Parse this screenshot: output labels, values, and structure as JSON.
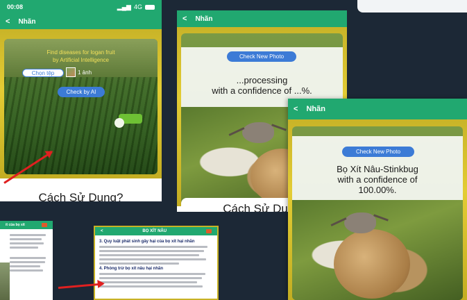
{
  "screenA": {
    "status_time": "00:08",
    "status_signal": "4G",
    "status_battery": "",
    "appbar_back": "<",
    "appbar_title": "Nhãn",
    "headline_line1": "Find diseases for logan fruit",
    "headline_line2": "by Artificial Intelligence",
    "choose_file_label": "Chọn tệp",
    "file_count_label": "1 ảnh",
    "check_ai_label": "Check by AI",
    "usage_title": "Cách Sử Dụng?"
  },
  "screenB": {
    "appbar_back": "<",
    "appbar_title": "Nhãn",
    "check_photo_label": "Check New Photo",
    "processing_line1": "...processing",
    "processing_line2": "with a confidence of ...%.",
    "usage_title": "Cách Sử Dụng"
  },
  "screenC": {
    "appbar_back": "<",
    "appbar_title": "Nhãn",
    "check_photo_label": "Check New Photo",
    "result_line1": "Bọ Xít Nâu-Stinkbug",
    "result_line2": "with a confidence of",
    "result_line3": "100.00%."
  },
  "screenF": {
    "appbar_title": "BỌ XÍT NÂU",
    "section3_title": "3. Quy luật phát sinh gây hại của bọ xít hại nhãn",
    "section4_title": "4. Phòng trừ bọ xít nâu hại nhãn"
  },
  "screenE": {
    "appbar_title": "ít của bọ xít"
  },
  "colors": {
    "appbar_green": "#21a870",
    "button_blue": "#3c7bd6",
    "frame_yellow": "#e3cc34",
    "arrow_red": "#e02020"
  }
}
